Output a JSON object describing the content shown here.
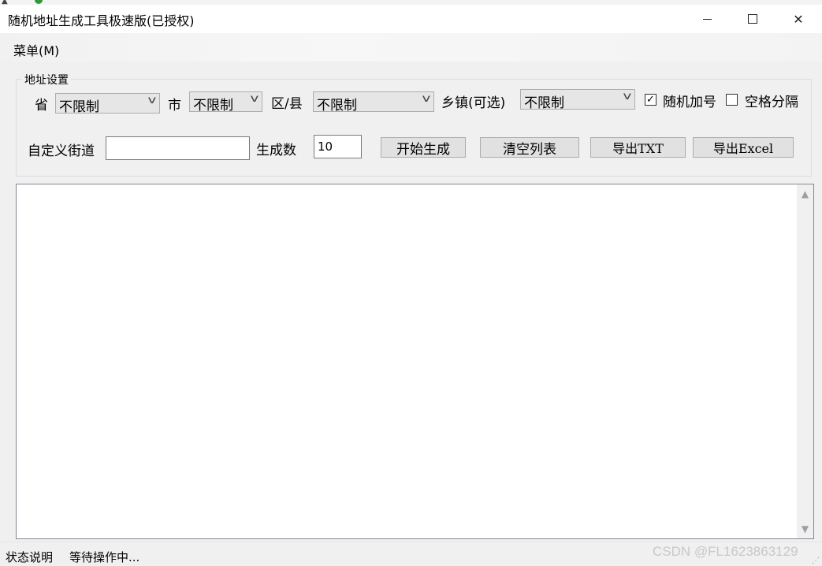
{
  "window": {
    "title": "随机地址生成工具极速版(已授权)",
    "min_icon": "minimize-icon",
    "max_icon": "maximize-icon",
    "close_icon": "close-icon",
    "close_glyph": "✕"
  },
  "menu": {
    "label": "菜单(M)"
  },
  "group": {
    "legend": "地址设置",
    "province_label": "省",
    "province_value": "不限制",
    "city_label": "市",
    "city_value": "不限制",
    "district_label": "区/县",
    "district_value": "不限制",
    "town_label": "乡镇(可选)",
    "town_value": "不限制",
    "random_number_label": "随机加号",
    "random_number_checked": true,
    "space_sep_label": "空格分隔",
    "space_sep_checked": false,
    "street_label": "自定义街道",
    "street_value": "",
    "count_label": "生成数",
    "count_value": "10",
    "start_button": "开始生成",
    "clear_button": "清空列表",
    "export_txt_button": "导出TXT",
    "export_excel_button": "导出Excel"
  },
  "status": {
    "label": "状态说明",
    "text": "等待操作中..."
  },
  "watermark": "CSDN @FL1623863129",
  "accent_colors": {
    "background": "#f0f0f0",
    "button": "#e1e1e1",
    "border": "#adadad"
  }
}
